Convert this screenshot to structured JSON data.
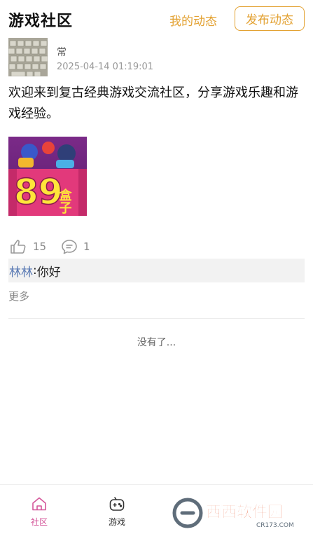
{
  "header": {
    "title": "游戏社区",
    "my_feed_label": "我的动态",
    "publish_label": "发布动态"
  },
  "post": {
    "username": "常",
    "timestamp": "2025-04-14 01:19:01",
    "text": "欢迎来到复古经典游戏交流社区，分享游戏乐趣和游戏经验。",
    "image": {
      "label_number": "89",
      "label_chars": "盒子"
    },
    "like_count": "15",
    "comment_count": "1",
    "comment": {
      "author": "林林",
      "separator": ":",
      "text": "你好"
    },
    "more_label": "更多"
  },
  "end_of_list": "没有了...",
  "tabbar": {
    "items": [
      {
        "label": "社区",
        "icon": "home-icon",
        "active": true
      },
      {
        "label": "游戏",
        "icon": "gamepad-icon",
        "active": false
      }
    ]
  },
  "watermark": {
    "text": "西西软件园",
    "subtext": "CR173.COM"
  },
  "colors": {
    "accent": "#e3a233",
    "active_tab": "#d4579a",
    "comment_author": "#5a7ab4"
  }
}
